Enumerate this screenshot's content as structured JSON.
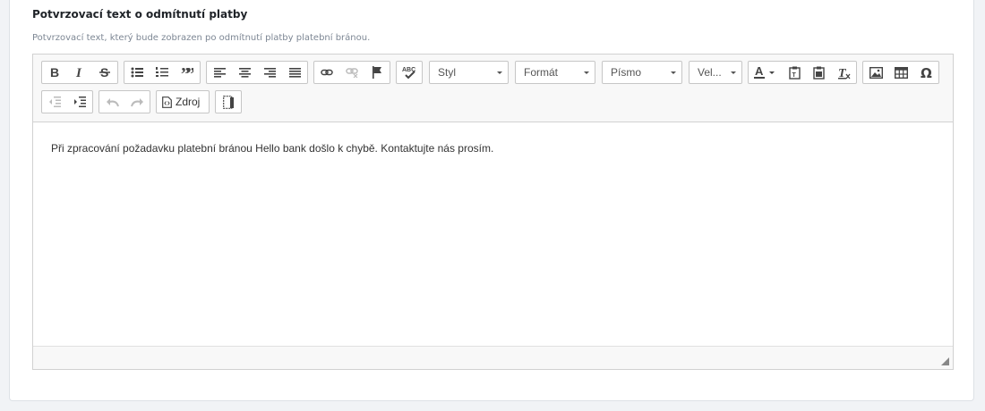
{
  "field": {
    "label": "Potvrzovací text o odmítnutí platby",
    "help": "Potvrzovací text, který bude zobrazen po odmítnutí platby platební bránou."
  },
  "toolbar": {
    "style_combo": "Styl",
    "format_combo": "Formát",
    "font_combo": "Písmo",
    "size_combo": "Vel...",
    "source_label": "Zdroj"
  },
  "editor": {
    "content": "Při zpracování požadavku platební bránou Hello bank došlo k chybě. Kontaktujte nás prosím."
  }
}
